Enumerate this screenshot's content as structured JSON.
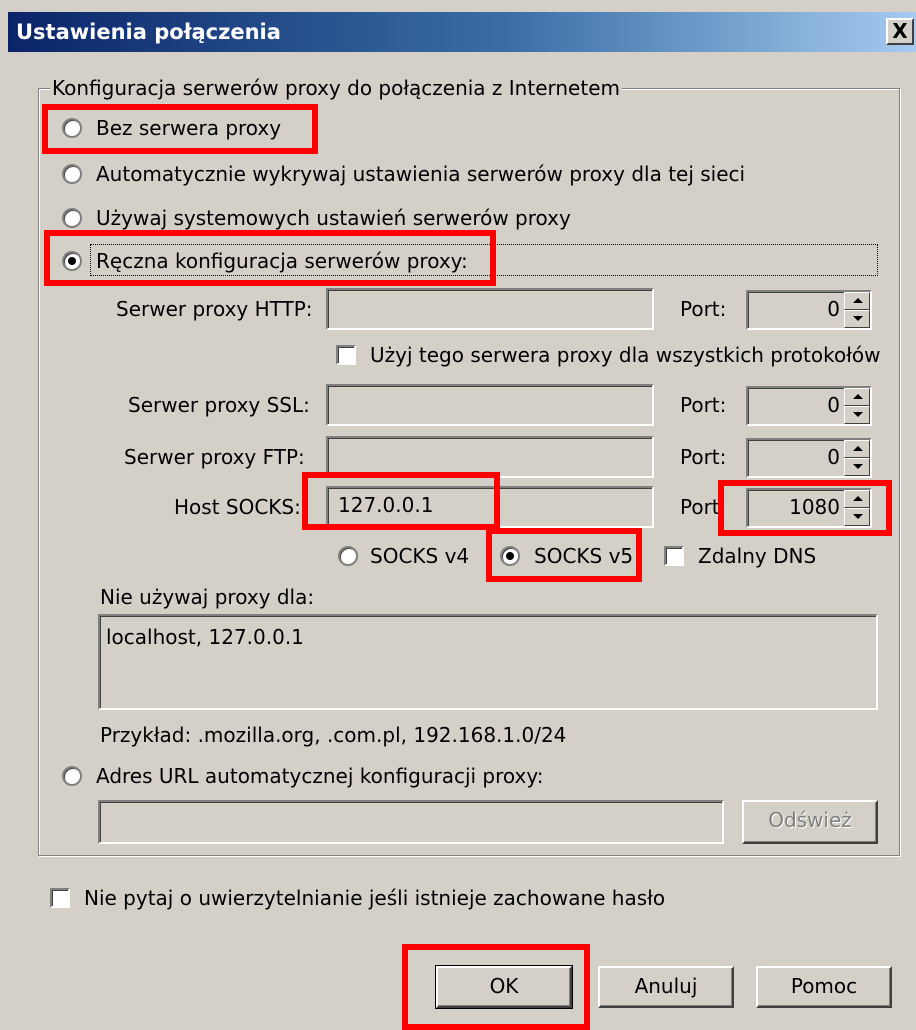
{
  "window": {
    "title": "Ustawienia połączenia",
    "close_label": "X"
  },
  "proxy_group": {
    "legend": "Konfiguracja serwerów proxy do połączenia z Internetem",
    "options": {
      "no_proxy": "Bez serwera proxy",
      "auto_detect": "Automatycznie wykrywaj ustawienia serwerów proxy dla tej sieci",
      "system": "Używaj systemowych ustawień serwerów proxy",
      "manual": "Ręczna konfiguracja serwerów proxy:",
      "auto_url": "Adres URL automatycznej konfiguracji proxy:"
    },
    "selected_option": "manual"
  },
  "manual": {
    "http_label": "Serwer proxy HTTP:",
    "http_value": "",
    "http_port_label": "Port:",
    "http_port_value": "0",
    "use_for_all_label": "Użyj tego serwera proxy dla wszystkich protokołów",
    "use_for_all_checked": false,
    "ssl_label": "Serwer proxy SSL:",
    "ssl_value": "",
    "ssl_port_label": "Port:",
    "ssl_port_value": "0",
    "ftp_label": "Serwer proxy FTP:",
    "ftp_value": "",
    "ftp_port_label": "Port:",
    "ftp_port_value": "0",
    "socks_label": "Host SOCKS:",
    "socks_value": "127.0.0.1",
    "socks_port_label": "Port:",
    "socks_port_value": "1080",
    "socks_v4_label": "SOCKS v4",
    "socks_v5_label": "SOCKS v5",
    "socks_version_selected": "v5",
    "remote_dns_label": "Zdalny DNS",
    "remote_dns_checked": false
  },
  "no_proxy_for": {
    "label": "Nie używaj proxy dla:",
    "value": "localhost, 127.0.0.1",
    "example": "Przykład: .mozilla.org, .com.pl, 192.168.1.0/24"
  },
  "auto_config": {
    "url_value": "",
    "refresh_label": "Odśwież"
  },
  "auth_checkbox": {
    "label": "Nie pytaj o uwierzytelnianie jeśli istnieje zachowane hasło",
    "checked": false
  },
  "buttons": {
    "ok": "OK",
    "cancel": "Anuluj",
    "help": "Pomoc"
  },
  "colors": {
    "dialog_bg": "#d4d0c8",
    "titlebar_start": "#0a246a",
    "titlebar_end": "#a6caf0",
    "highlight": "#ff0000"
  }
}
